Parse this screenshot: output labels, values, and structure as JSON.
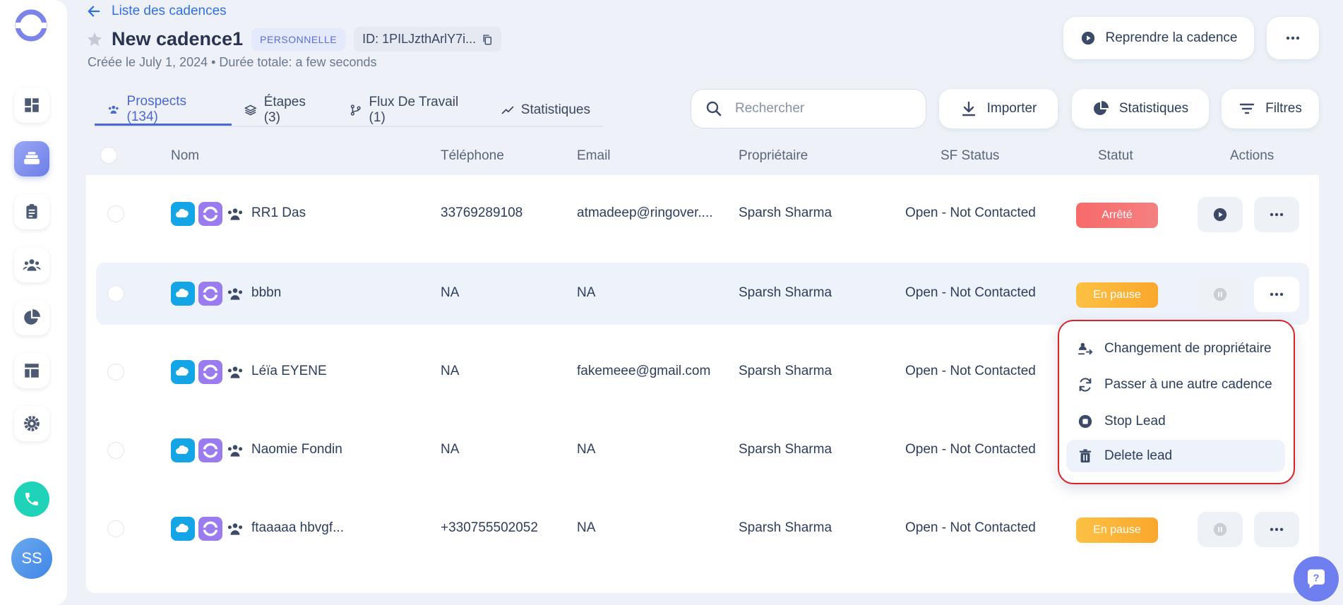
{
  "header": {
    "back_label": "Liste des cadences",
    "title": "New cadence1",
    "badge": "PERSONNELLE",
    "id_text": "ID: 1PILJzthArlY7i...",
    "subtitle": "Créée le July 1, 2024 • Durée totale: a few seconds",
    "resume_label": "Reprendre la cadence"
  },
  "tabs": [
    {
      "label": "Prospects (134)",
      "icon": "users-icon",
      "active": true
    },
    {
      "label": "Étapes (3)",
      "icon": "layers-icon"
    },
    {
      "label": "Flux De Travail (1)",
      "icon": "workflow-icon"
    },
    {
      "label": "Statistiques",
      "icon": "trend-icon"
    }
  ],
  "toolbar": {
    "search_placeholder": "Rechercher",
    "import_label": "Importer",
    "stats_label": "Statistiques",
    "filters_label": "Filtres"
  },
  "table": {
    "columns": [
      "Nom",
      "Téléphone",
      "Email",
      "Propriétaire",
      "SF Status",
      "Statut",
      "Actions"
    ],
    "rows": [
      {
        "name": "RR1 Das",
        "phone": "33769289108",
        "email": "atmadeep@ringover....",
        "owner": "Sparsh Sharma",
        "sf_status": "Open - Not Contacted",
        "status": "Arrêté"
      },
      {
        "name": "bbbn",
        "phone": "NA",
        "email": "NA",
        "owner": "Sparsh Sharma",
        "sf_status": "Open - Not Contacted",
        "status": "En pause"
      },
      {
        "name": "Léïa EYENE",
        "phone": "NA",
        "email": "fakemeee@gmail.com",
        "owner": "Sparsh Sharma",
        "sf_status": "Open - Not Contacted",
        "status": ""
      },
      {
        "name": "Naomie Fondin",
        "phone": "NA",
        "email": "NA",
        "owner": "Sparsh Sharma",
        "sf_status": "Open - Not Contacted",
        "status": ""
      },
      {
        "name": "ftaaaaa hbvgf...",
        "phone": "+330755502052",
        "email": "NA",
        "owner": "Sparsh Sharma",
        "sf_status": "Open - Not Contacted",
        "status": "En pause"
      }
    ]
  },
  "dropdown": {
    "items": [
      {
        "label": "Changement de propriétaire",
        "icon": "owner-change-icon"
      },
      {
        "label": "Passer à une autre cadence",
        "icon": "refresh-icon"
      },
      {
        "label": "Stop Lead",
        "icon": "stop-icon"
      },
      {
        "label": "Delete lead",
        "icon": "trash-icon"
      }
    ]
  },
  "user": {
    "initials": "SS"
  },
  "colors": {
    "accent": "#4a67d6",
    "stopped": "#f76a6a",
    "paused": "#fdc144",
    "salesforce": "#13a5e6",
    "ringover": "#9b7cf0",
    "highlight_border": "#d9232a"
  }
}
